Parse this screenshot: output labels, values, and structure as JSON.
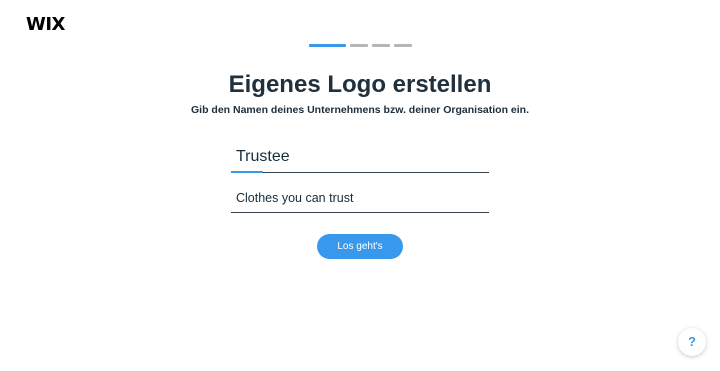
{
  "brand": {
    "logo_text": "WIX"
  },
  "progress": {
    "total_steps": 4,
    "current_step": 1,
    "active_color": "#3899ec",
    "inactive_color": "#b6b6b6"
  },
  "main": {
    "title": "Eigenes Logo erstellen",
    "subtitle": "Gib den Namen deines Unternehmens bzw. deiner Organisation ein."
  },
  "form": {
    "name_value": "Trustee",
    "slogan_value": "Clothes you can trust",
    "submit_label": "Los geht's"
  },
  "help": {
    "icon": "question-mark-icon",
    "label": "?"
  },
  "colors": {
    "accent": "#3899ec",
    "text": "#20303c"
  }
}
